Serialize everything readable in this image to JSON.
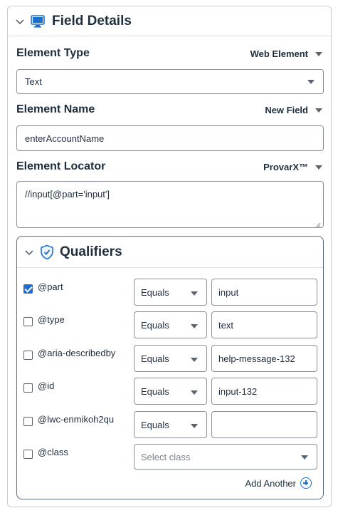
{
  "panel": {
    "title": "Field Details",
    "icons": {
      "collapse": "chevron-down-icon",
      "type": "monitor-icon"
    }
  },
  "element_type": {
    "label": "Element Type",
    "mode": "Web Element",
    "value": "Text"
  },
  "element_name": {
    "label": "Element Name",
    "mode": "New Field",
    "value": "enterAccountName"
  },
  "element_locator": {
    "label": "Element Locator",
    "mode": "ProvarX™",
    "value": "//input[@part='input']"
  },
  "qualifiers": {
    "title": "Qualifiers",
    "icon": "shield-check-icon",
    "rows": [
      {
        "name": "@part",
        "checked": true,
        "operator": "Equals",
        "value": "input"
      },
      {
        "name": "@type",
        "checked": false,
        "operator": "Equals",
        "value": "text"
      },
      {
        "name": "@aria-describedby",
        "checked": false,
        "operator": "Equals",
        "value": "help-message-132"
      },
      {
        "name": "@id",
        "checked": false,
        "operator": "Equals",
        "value": "input-132"
      },
      {
        "name": "@lwc-enmikoh2qu",
        "checked": false,
        "operator": "Equals",
        "value": ""
      }
    ],
    "class_row": {
      "name": "@class",
      "checked": false,
      "placeholder": "Select class"
    },
    "add_another": "Add Another"
  },
  "colors": {
    "accent": "#1b6fd1",
    "text": "#1f2d3d",
    "border": "#8a9099"
  }
}
